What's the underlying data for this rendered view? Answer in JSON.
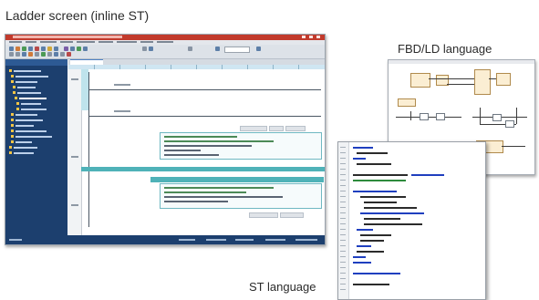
{
  "captions": {
    "ladder": "Ladder screen (inline ST)",
    "fbd": "FBD/LD language",
    "st": "ST language"
  },
  "colors": {
    "title_bar": "#c23a2c",
    "navigator": "#1c3f6e",
    "inline_st_highlight": "#4fb2b8",
    "fbd_block": "#fbeed3",
    "st_keyword": "#1f3fbf",
    "st_comment": "#2e8b3d"
  },
  "screens": {
    "ladder_window_icon": "ladder-editor-window",
    "fbd_window_icon": "fbd-ld-editor-window",
    "st_window_icon": "st-editor-window"
  }
}
